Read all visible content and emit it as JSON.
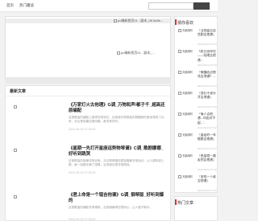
{
  "nav": {
    "home": "首页",
    "category": "热门趣谈"
  },
  "banner": {
    "alt1": "pc端新首页01 - 副本_06.5a3b...",
    "alt2": "pc端新首页01 - 副本_..."
  },
  "latest": {
    "heading": "最新文章",
    "items": [
      {
        "thumb_alt": "《万家灯火古...",
        "title": "《万家灯火古他理》G调_万物和声/都子千_超高还原编配",
        "desc": "这首歌曲的编配上做得非常到位，吉他谱中把原曲的精髓都完整地表现了出来，无论是前奏还是间奏，都非常好听。",
        "date": "2024-09-10 07:33:00"
      },
      {
        "thumb_alt": "《星期一先...",
        "title": "《星期一先打开星座运势物琴谱》C调_歌剧娜娜_好听到跳哭",
        "desc": "这首歌曲的旋律非常优美，无论是弹唱还是独奏都非常适合，让人越听越上瘾，每一段都充满了感情，吉他谱也是非常精良。",
        "date": "2024-09-10 07:33:00"
      },
      {
        "thumb_alt": "《君上命是...",
        "title": "《君上命是一个错吉他谱》G调_钢琴版_好听到爆的",
        "desc": "这首歌曲的编配非常精致，吉他谱编得也很用心，让人爱不释手。",
        "date": "2024-09-10 07:33:00"
      }
    ]
  },
  "sidebar": {
    "heading": "猜你喜欢",
    "items": [
      {
        "thumb_alt": "天鹅阁阿",
        "title": "『当我爱过这些剧吉他谱』",
        "date": "2024-09-10 07:33"
      },
      {
        "thumb_alt": "天鹅阁阿",
        "title": "《愿月亮停住——陆地吉他谱...",
        "date": "2024-09-10 07:33"
      },
      {
        "thumb_alt": "天鹅阁阿",
        "title": "『微醺而过桃花吉他谱》...",
        "date": "2024-09-10 07:33"
      },
      {
        "thumb_alt": "天鹅阁阿",
        "title": "『我们不该分开吉他谱』 ",
        "date": "2024-09-10 07:33"
      },
      {
        "thumb_alt": "天鹅阁阿",
        "title": "『情人吉他谱...叫出对不起...', ",
        "date": "2024-09-10 07:33"
      },
      {
        "thumb_alt": "天鹅阁阿",
        "title": "『要走的一年能能吉他谱』",
        "date": "2024-09-10 07:33"
      },
      {
        "thumb_alt": "天鹅阁阿",
        "title": "『热爱就一路走到吉他谱』",
        "date": "2024-09-10 07:33"
      },
      {
        "thumb_alt": "天鹅阁阿",
        "title": "『安慰一下谁吉他谱』",
        "date": "2024-09-10 07:33"
      }
    ]
  },
  "sidebar2": {
    "heading": "热门文章"
  }
}
